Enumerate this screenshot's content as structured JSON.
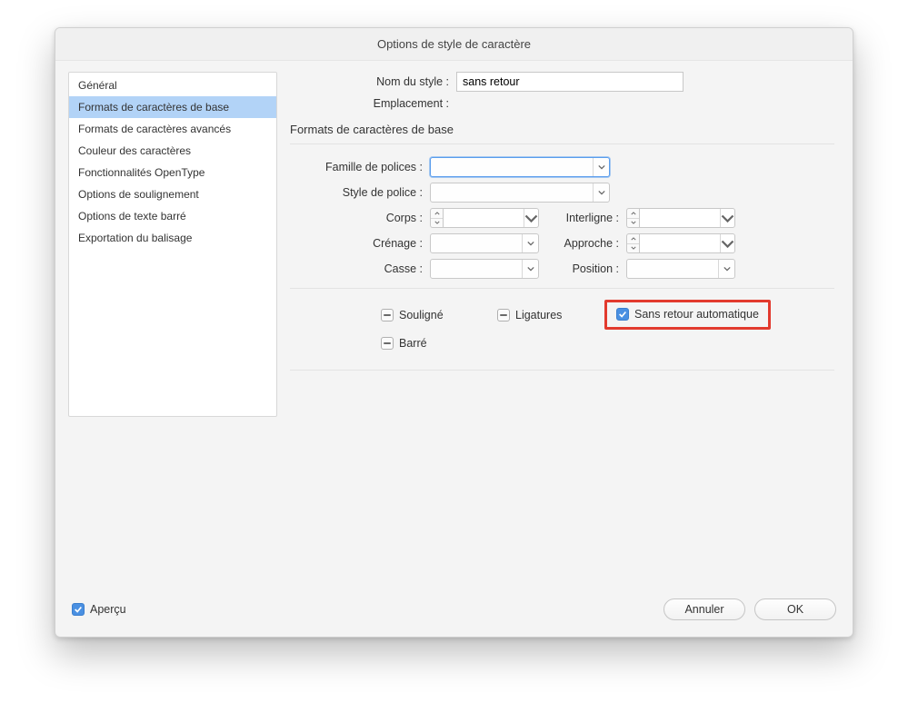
{
  "dialog": {
    "title": "Options de style de caractère"
  },
  "sidebar": {
    "items": [
      {
        "label": "Général",
        "selected": false
      },
      {
        "label": "Formats de caractères de base",
        "selected": true
      },
      {
        "label": "Formats de caractères avancés",
        "selected": false
      },
      {
        "label": "Couleur des caractères",
        "selected": false
      },
      {
        "label": "Fonctionnalités OpenType",
        "selected": false
      },
      {
        "label": "Options de soulignement",
        "selected": false
      },
      {
        "label": "Options de texte barré",
        "selected": false
      },
      {
        "label": "Exportation du balisage",
        "selected": false
      }
    ]
  },
  "header": {
    "style_name_label": "Nom du style :",
    "style_name_value": "sans retour",
    "location_label": "Emplacement :",
    "section_title": "Formats de caractères de base"
  },
  "fields": {
    "font_family_label": "Famille de polices :",
    "font_style_label": "Style de police :",
    "size_label": "Corps :",
    "leading_label": "Interligne :",
    "kerning_label": "Crénage :",
    "tracking_label": "Approche :",
    "case_label": "Casse :",
    "position_label": "Position :"
  },
  "checkboxes": {
    "underline": "Souligné",
    "strikethrough": "Barré",
    "ligatures": "Ligatures",
    "no_break": "Sans retour automatique"
  },
  "footer": {
    "preview_label": "Aperçu",
    "cancel": "Annuler",
    "ok": "OK"
  }
}
